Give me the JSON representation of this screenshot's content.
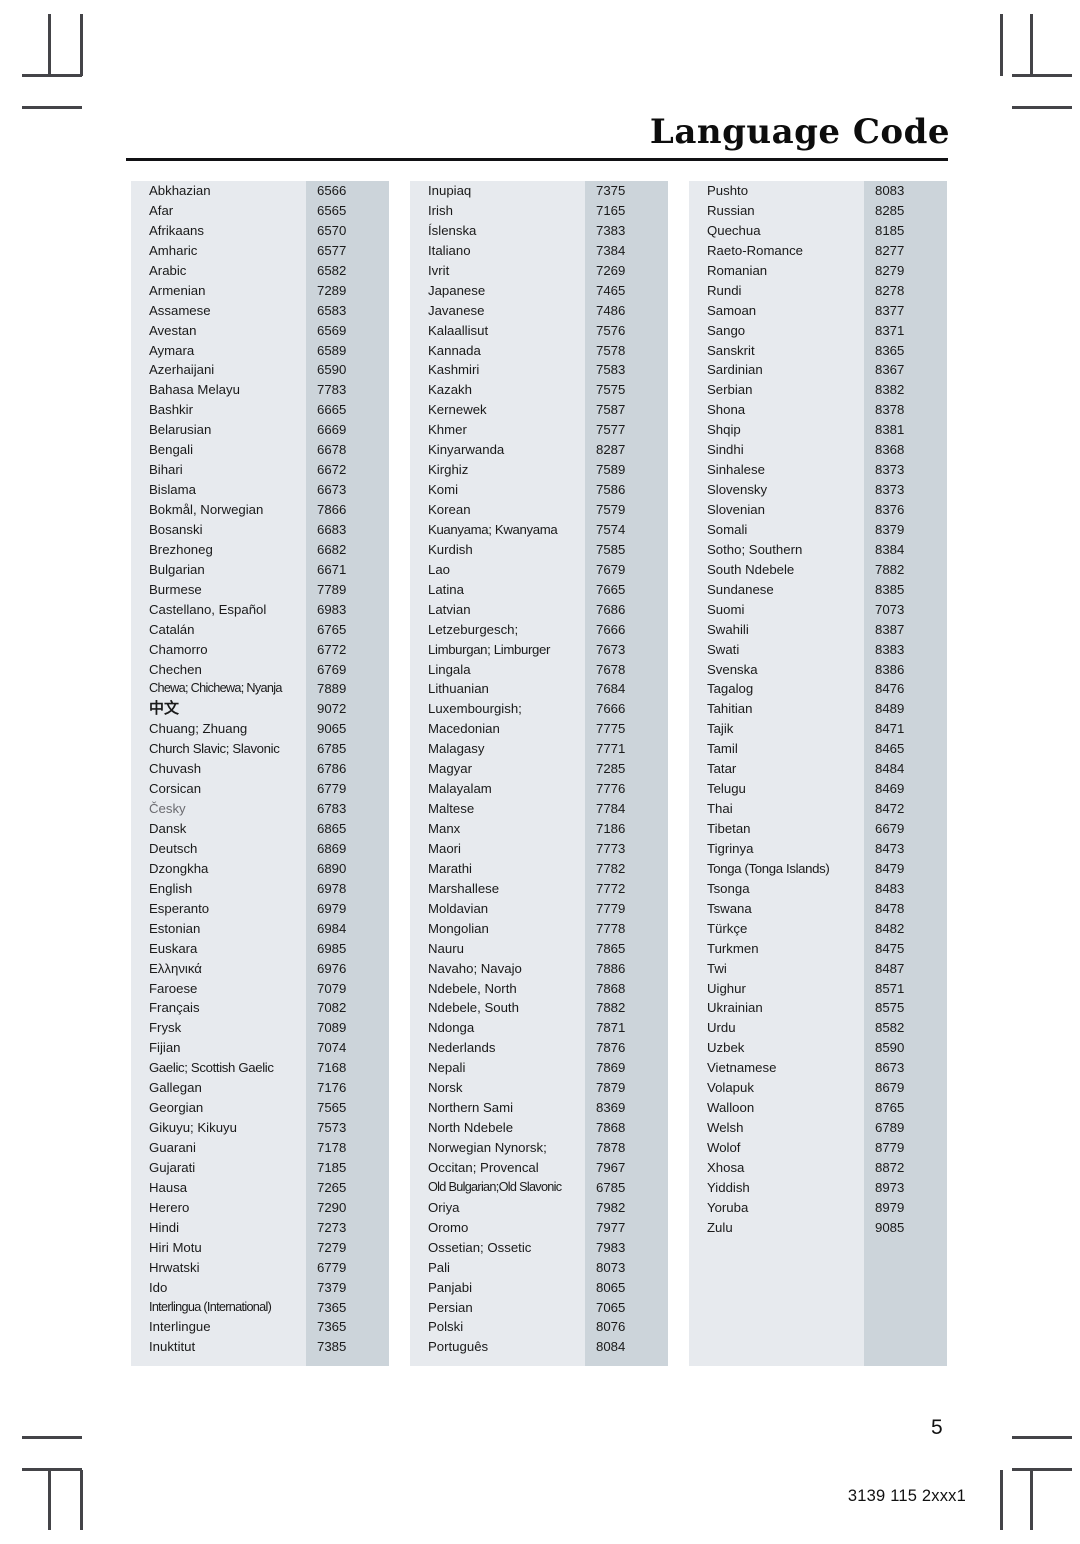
{
  "header": {
    "title": "Language Code"
  },
  "footer": {
    "page_number": "5",
    "document_code": "3139 115 2xxx1"
  },
  "table": {
    "columns": [
      {
        "id": "column-1",
        "rows": [
          {
            "language": "Abkhazian",
            "code": "6566"
          },
          {
            "language": "Afar",
            "code": "6565"
          },
          {
            "language": "Afrikaans",
            "code": "6570"
          },
          {
            "language": "Amharic",
            "code": "6577"
          },
          {
            "language": "Arabic",
            "code": "6582"
          },
          {
            "language": "Armenian",
            "code": "7289"
          },
          {
            "language": "Assamese",
            "code": "6583"
          },
          {
            "language": "Avestan",
            "code": "6569"
          },
          {
            "language": "Aymara",
            "code": "6589"
          },
          {
            "language": "Azerhaijani",
            "code": "6590"
          },
          {
            "language": "Bahasa Melayu",
            "code": "7783"
          },
          {
            "language": "Bashkir",
            "code": "6665"
          },
          {
            "language": "Belarusian",
            "code": "6669"
          },
          {
            "language": "Bengali",
            "code": "6678"
          },
          {
            "language": "Bihari",
            "code": "6672"
          },
          {
            "language": "Bislama",
            "code": "6673"
          },
          {
            "language": "Bokmål, Norwegian",
            "code": "7866"
          },
          {
            "language": "Bosanski",
            "code": "6683"
          },
          {
            "language": "Brezhoneg",
            "code": "6682"
          },
          {
            "language": "Bulgarian",
            "code": "6671"
          },
          {
            "language": "Burmese",
            "code": "7789"
          },
          {
            "language": "Castellano, Español",
            "code": "6983"
          },
          {
            "language": "Catalán",
            "code": "6765"
          },
          {
            "language": "Chamorro",
            "code": "6772"
          },
          {
            "language": "Chechen",
            "code": "6769"
          },
          {
            "language": "Chewa; Chichewa; Nyanja",
            "code": "7889",
            "style": "vtight"
          },
          {
            "language": "中文",
            "code": "9072",
            "style": "cjk"
          },
          {
            "language": "Chuang; Zhuang",
            "code": "9065"
          },
          {
            "language": "Church Slavic; Slavonic",
            "code": "6785",
            "style": "tight"
          },
          {
            "language": "Chuvash",
            "code": "6786"
          },
          {
            "language": "Corsican",
            "code": "6779"
          },
          {
            "language": "Česky",
            "code": "6783",
            "style": "accent"
          },
          {
            "language": "Dansk",
            "code": "6865"
          },
          {
            "language": "Deutsch",
            "code": "6869"
          },
          {
            "language": "Dzongkha",
            "code": "6890"
          },
          {
            "language": "English",
            "code": "6978"
          },
          {
            "language": "Esperanto",
            "code": "6979"
          },
          {
            "language": "Estonian",
            "code": "6984"
          },
          {
            "language": "Euskara",
            "code": "6985"
          },
          {
            "language": "Ελληνικά",
            "code": "6976"
          },
          {
            "language": "Faroese",
            "code": "7079"
          },
          {
            "language": "Français",
            "code": "7082"
          },
          {
            "language": "Frysk",
            "code": "7089"
          },
          {
            "language": "Fijian",
            "code": "7074"
          },
          {
            "language": "Gaelic; Scottish Gaelic",
            "code": "7168",
            "style": "tight"
          },
          {
            "language": "Gallegan",
            "code": "7176"
          },
          {
            "language": "Georgian",
            "code": "7565"
          },
          {
            "language": "Gikuyu; Kikuyu",
            "code": "7573"
          },
          {
            "language": "Guarani",
            "code": "7178"
          },
          {
            "language": "Gujarati",
            "code": "7185"
          },
          {
            "language": "Hausa",
            "code": "7265"
          },
          {
            "language": "Herero",
            "code": "7290"
          },
          {
            "language": "Hindi",
            "code": "7273"
          },
          {
            "language": "Hiri Motu",
            "code": "7279"
          },
          {
            "language": "Hrwatski",
            "code": "6779"
          },
          {
            "language": "Ido",
            "code": "7379"
          },
          {
            "language": "Interlingua (International)",
            "code": "7365",
            "style": "vtight"
          },
          {
            "language": "Interlingue",
            "code": "7365"
          },
          {
            "language": "Inuktitut",
            "code": "7385"
          }
        ]
      },
      {
        "id": "column-2",
        "rows": [
          {
            "language": "Inupiaq",
            "code": "7375"
          },
          {
            "language": "Irish",
            "code": "7165"
          },
          {
            "language": "Íslenska",
            "code": "7383"
          },
          {
            "language": "Italiano",
            "code": "7384"
          },
          {
            "language": "Ivrit",
            "code": "7269"
          },
          {
            "language": "Japanese",
            "code": "7465"
          },
          {
            "language": "Javanese",
            "code": "7486"
          },
          {
            "language": "Kalaallisut",
            "code": "7576"
          },
          {
            "language": "Kannada",
            "code": "7578"
          },
          {
            "language": "Kashmiri",
            "code": "7583"
          },
          {
            "language": "Kazakh",
            "code": "7575"
          },
          {
            "language": "Kernewek",
            "code": "7587"
          },
          {
            "language": "Khmer",
            "code": "7577"
          },
          {
            "language": "Kinyarwanda",
            "code": "8287"
          },
          {
            "language": "Kirghiz",
            "code": "7589"
          },
          {
            "language": "Komi",
            "code": "7586"
          },
          {
            "language": "Korean",
            "code": "7579"
          },
          {
            "language": "Kuanyama; Kwanyama",
            "code": "7574",
            "style": "tight"
          },
          {
            "language": "Kurdish",
            "code": "7585"
          },
          {
            "language": "Lao",
            "code": "7679"
          },
          {
            "language": "Latina",
            "code": "7665"
          },
          {
            "language": "Latvian",
            "code": "7686"
          },
          {
            "language": "Letzeburgesch;",
            "code": "7666"
          },
          {
            "language": "Limburgan; Limburger",
            "code": "7673",
            "style": "tight"
          },
          {
            "language": "Lingala",
            "code": "7678"
          },
          {
            "language": "Lithuanian",
            "code": "7684"
          },
          {
            "language": "Luxembourgish;",
            "code": "7666"
          },
          {
            "language": "Macedonian",
            "code": "7775"
          },
          {
            "language": "Malagasy",
            "code": "7771"
          },
          {
            "language": "Magyar",
            "code": "7285"
          },
          {
            "language": "Malayalam",
            "code": "7776"
          },
          {
            "language": "Maltese",
            "code": "7784"
          },
          {
            "language": "Manx",
            "code": "7186"
          },
          {
            "language": "Maori",
            "code": "7773"
          },
          {
            "language": "Marathi",
            "code": "7782"
          },
          {
            "language": "Marshallese",
            "code": "7772"
          },
          {
            "language": "Moldavian",
            "code": "7779"
          },
          {
            "language": "Mongolian",
            "code": "7778"
          },
          {
            "language": "Nauru",
            "code": "7865"
          },
          {
            "language": "Navaho; Navajo",
            "code": "7886"
          },
          {
            "language": "Ndebele, North",
            "code": "7868"
          },
          {
            "language": "Ndebele, South",
            "code": "7882"
          },
          {
            "language": "Ndonga",
            "code": "7871"
          },
          {
            "language": "Nederlands",
            "code": "7876"
          },
          {
            "language": "Nepali",
            "code": "7869"
          },
          {
            "language": "Norsk",
            "code": "7879"
          },
          {
            "language": "Northern Sami",
            "code": "8369"
          },
          {
            "language": "North Ndebele",
            "code": "7868"
          },
          {
            "language": "Norwegian Nynorsk;",
            "code": "7878"
          },
          {
            "language": "Occitan; Provencal",
            "code": "7967"
          },
          {
            "language": "Old Bulgarian;Old Slavonic",
            "code": "6785",
            "style": "vtight"
          },
          {
            "language": "Oriya",
            "code": "7982"
          },
          {
            "language": "Oromo",
            "code": "7977"
          },
          {
            "language": "Ossetian; Ossetic",
            "code": "7983"
          },
          {
            "language": "Pali",
            "code": "8073"
          },
          {
            "language": "Panjabi",
            "code": "8065"
          },
          {
            "language": "Persian",
            "code": "7065"
          },
          {
            "language": "Polski",
            "code": "8076"
          },
          {
            "language": "Português",
            "code": "8084"
          }
        ]
      },
      {
        "id": "column-3",
        "rows": [
          {
            "language": "Pushto",
            "code": "8083"
          },
          {
            "language": "Russian",
            "code": "8285"
          },
          {
            "language": "Quechua",
            "code": "8185"
          },
          {
            "language": "Raeto-Romance",
            "code": "8277"
          },
          {
            "language": "Romanian",
            "code": "8279"
          },
          {
            "language": "Rundi",
            "code": "8278"
          },
          {
            "language": "Samoan",
            "code": "8377"
          },
          {
            "language": "Sango",
            "code": "8371"
          },
          {
            "language": "Sanskrit",
            "code": "8365"
          },
          {
            "language": "Sardinian",
            "code": "8367"
          },
          {
            "language": "Serbian",
            "code": "8382"
          },
          {
            "language": "Shona",
            "code": "8378"
          },
          {
            "language": "Shqip",
            "code": "8381"
          },
          {
            "language": "Sindhi",
            "code": "8368"
          },
          {
            "language": "Sinhalese",
            "code": "8373"
          },
          {
            "language": "Slovensky",
            "code": "8373"
          },
          {
            "language": "Slovenian",
            "code": "8376"
          },
          {
            "language": "Somali",
            "code": "8379"
          },
          {
            "language": "Sotho; Southern",
            "code": "8384"
          },
          {
            "language": "South Ndebele",
            "code": "7882"
          },
          {
            "language": "Sundanese",
            "code": "8385"
          },
          {
            "language": "Suomi",
            "code": "7073"
          },
          {
            "language": "Swahili",
            "code": "8387"
          },
          {
            "language": "Swati",
            "code": "8383"
          },
          {
            "language": "Svenska",
            "code": "8386"
          },
          {
            "language": "Tagalog",
            "code": "8476"
          },
          {
            "language": "Tahitian",
            "code": "8489"
          },
          {
            "language": "Tajik",
            "code": "8471"
          },
          {
            "language": "Tamil",
            "code": "8465"
          },
          {
            "language": "Tatar",
            "code": "8484"
          },
          {
            "language": "Telugu",
            "code": "8469"
          },
          {
            "language": "Thai",
            "code": "8472"
          },
          {
            "language": "Tibetan",
            "code": "6679"
          },
          {
            "language": "Tigrinya",
            "code": "8473"
          },
          {
            "language": "Tonga (Tonga Islands)",
            "code": "8479",
            "style": "tight"
          },
          {
            "language": "Tsonga",
            "code": "8483"
          },
          {
            "language": "Tswana",
            "code": "8478"
          },
          {
            "language": "Türkçe",
            "code": "8482"
          },
          {
            "language": "Turkmen",
            "code": "8475"
          },
          {
            "language": "Twi",
            "code": "8487"
          },
          {
            "language": "Uighur",
            "code": "8571"
          },
          {
            "language": "Ukrainian",
            "code": "8575"
          },
          {
            "language": "Urdu",
            "code": "8582"
          },
          {
            "language": "Uzbek",
            "code": "8590"
          },
          {
            "language": "Vietnamese",
            "code": "8673"
          },
          {
            "language": "Volapuk",
            "code": "8679"
          },
          {
            "language": "Walloon",
            "code": "8765"
          },
          {
            "language": "Welsh",
            "code": "6789"
          },
          {
            "language": "Wolof",
            "code": "8779"
          },
          {
            "language": "Xhosa",
            "code": "8872"
          },
          {
            "language": "Yiddish",
            "code": "8973"
          },
          {
            "language": "Yoruba",
            "code": "8979"
          },
          {
            "language": "Zulu",
            "code": "9085"
          }
        ]
      }
    ]
  },
  "colors": {
    "name_column_bg": "#e7eaee",
    "code_column_bg": "#ccd4da",
    "rule": "#111114",
    "text": "#1a1a1a",
    "crop_mark": "#444448"
  }
}
